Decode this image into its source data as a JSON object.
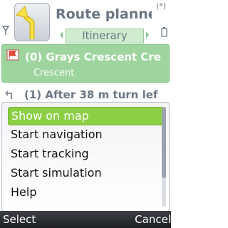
{
  "status": {
    "bluetooth_label": "(*)"
  },
  "header": {
    "title": "Route planner",
    "tab": "Itinerary"
  },
  "list": {
    "items": [
      {
        "title": "(0) Grays Crescent Cre",
        "subtitle": "Crescent",
        "icon": "flag-icon"
      },
      {
        "title": "(1) After 38 m turn lef",
        "icon": "turn-left-icon"
      }
    ]
  },
  "menu": {
    "items": [
      {
        "label": "Show on map",
        "selected": true
      },
      {
        "label": "Start navigation"
      },
      {
        "label": "Start tracking"
      },
      {
        "label": "Start simulation"
      },
      {
        "label": "Help"
      }
    ]
  },
  "softkeys": {
    "left": "Select",
    "right": "Cancel"
  },
  "colors": {
    "accent": "#8ccf45",
    "list_highlight": "#9ed49e",
    "title_text": "#6b7785",
    "softkey_bar": "#2a2c30"
  }
}
